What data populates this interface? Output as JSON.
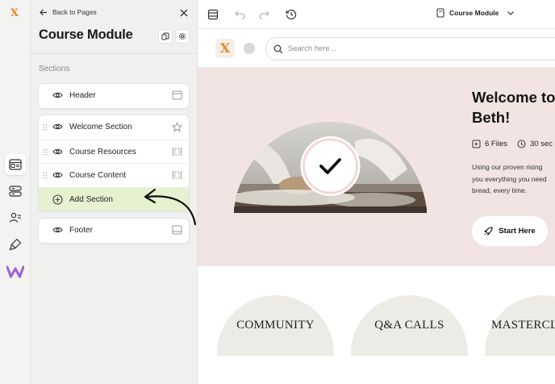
{
  "panel": {
    "back_label": "Back to Pages",
    "title": "Course Module",
    "sections_label": "Sections",
    "header_item": "Header",
    "items": [
      {
        "label": "Welcome Section",
        "icon": "star-icon"
      },
      {
        "label": "Course Resources",
        "icon": "resize-horizontal-icon"
      },
      {
        "label": "Course Content",
        "icon": "resize-horizontal-icon"
      }
    ],
    "add_section_label": "Add Section",
    "footer_item": "Footer"
  },
  "topbar": {
    "page_label": "Course Module"
  },
  "preview": {
    "search_placeholder": "Search here...",
    "welcome_line1": "Welcome to",
    "welcome_line2": "Beth!",
    "files": "6 Files",
    "duration": "30 sec",
    "desc_line1": "Using our proven rising",
    "desc_line2": "you everything you need",
    "desc_line3": "bread, every time.",
    "start_label": "Start Here",
    "tiles": [
      "COMMUNITY",
      "Q&A CALLS",
      "MASTERCL"
    ]
  },
  "colors": {
    "add_section_bg": "#e6f1cf",
    "hero_bg": "#f3e4e4",
    "brand_orange": "#e58a2d",
    "tile_bg": "#ecebe6"
  }
}
